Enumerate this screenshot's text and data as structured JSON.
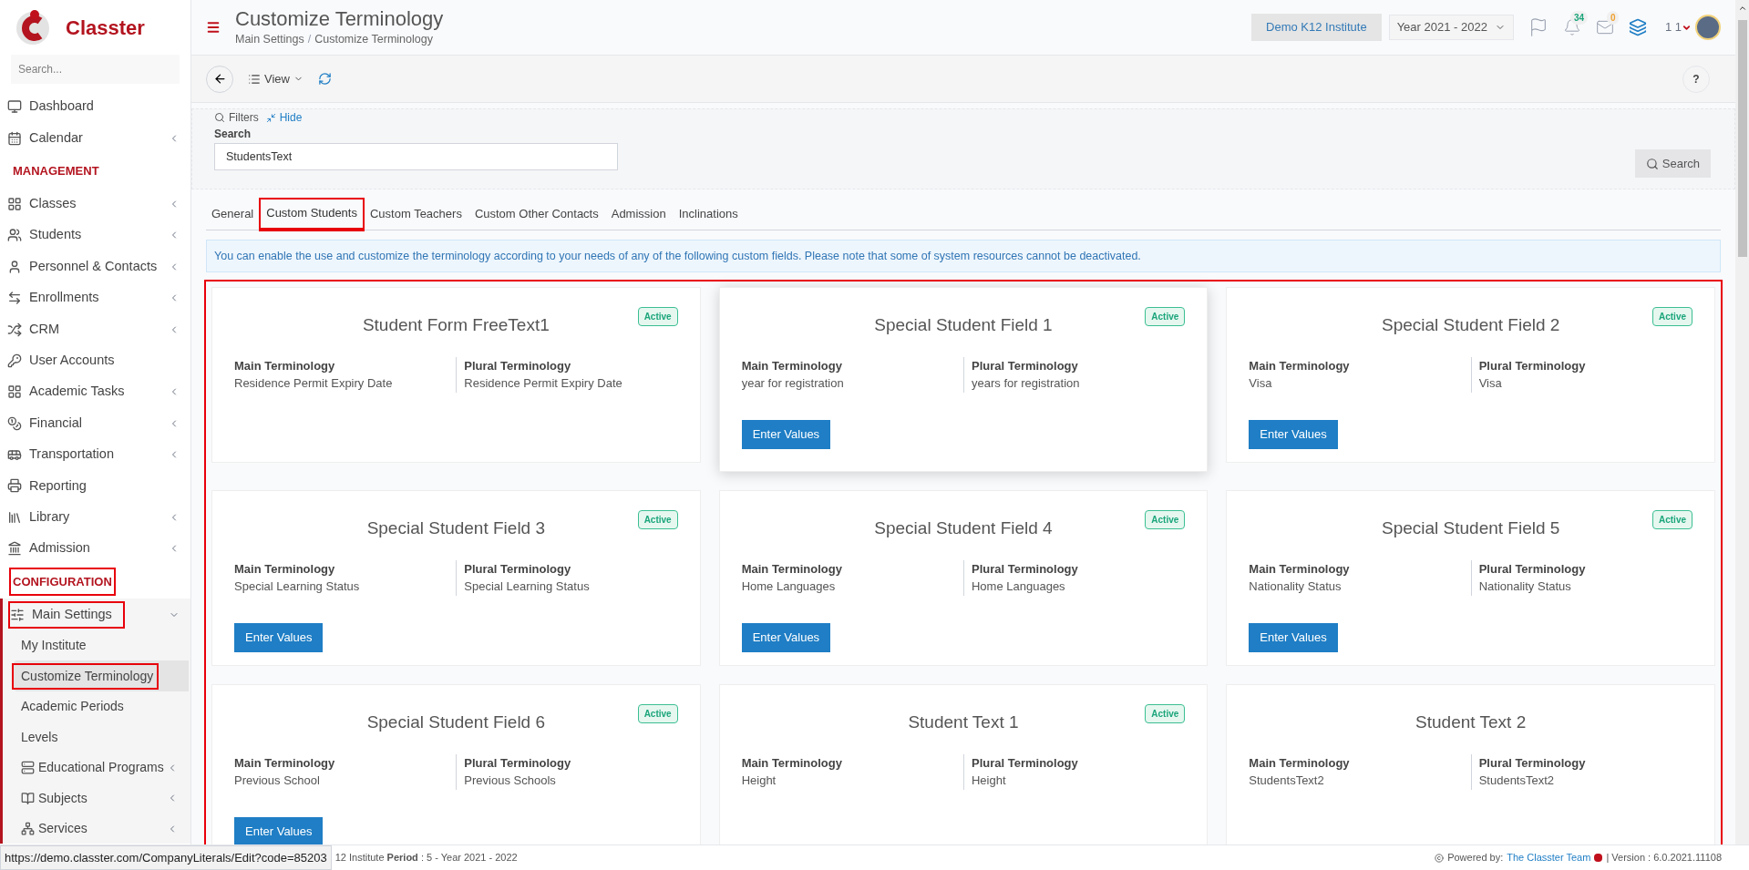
{
  "brand": {
    "name": "Classter"
  },
  "sidebar": {
    "search_placeholder": "Search...",
    "groups": [
      {
        "items": [
          {
            "label": "Dashboard",
            "has_submenu": false
          },
          {
            "label": "Calendar",
            "has_submenu": true
          }
        ]
      },
      {
        "heading": {
          "text": "MANAGEMENT",
          "annotated": false
        },
        "items": [
          {
            "label": "Classes",
            "has_submenu": true
          },
          {
            "label": "Students",
            "has_submenu": true
          },
          {
            "label": "Personnel & Contacts",
            "has_submenu": true
          },
          {
            "label": "Enrollments",
            "has_submenu": true
          },
          {
            "label": "CRM",
            "has_submenu": true
          },
          {
            "label": "User Accounts",
            "has_submenu": false
          },
          {
            "label": "Academic Tasks",
            "has_submenu": true
          },
          {
            "label": "Financial",
            "has_submenu": true
          },
          {
            "label": "Transportation",
            "has_submenu": true
          },
          {
            "label": "Reporting",
            "has_submenu": false
          },
          {
            "label": "Library",
            "has_submenu": true
          },
          {
            "label": "Admission",
            "has_submenu": true
          }
        ]
      },
      {
        "heading": {
          "text": "CONFIGURATION",
          "annotated": true
        },
        "items": [
          {
            "label": "Main Settings",
            "has_submenu": true,
            "expanded": true,
            "annotated": true,
            "children": [
              {
                "label": "My Institute",
                "selected": false,
                "annotated": false,
                "has_submenu": false
              },
              {
                "label": "Customize Terminology",
                "selected": true,
                "annotated": true,
                "has_submenu": false
              },
              {
                "label": "Academic Periods",
                "selected": false,
                "annotated": false,
                "has_submenu": false
              },
              {
                "label": "Levels",
                "selected": false,
                "annotated": false,
                "has_submenu": false
              },
              {
                "label": "Educational Programs",
                "selected": false,
                "annotated": false,
                "has_submenu": true
              },
              {
                "label": "Subjects",
                "selected": false,
                "annotated": false,
                "has_submenu": true
              },
              {
                "label": "Services",
                "selected": false,
                "annotated": false,
                "has_submenu": true
              }
            ]
          }
        ]
      }
    ]
  },
  "header": {
    "title": "Customize Terminology",
    "breadcrumbs": [
      "Main Settings",
      "Customize Terminology"
    ],
    "breadcrumb_separator": "/",
    "institute": "Demo K12 Institute",
    "year": "Year 2021 - 2022",
    "notifications": "34",
    "messages": "0",
    "user": "1 1"
  },
  "toolbar": {
    "view": "View",
    "help": "?"
  },
  "filters": {
    "label": "Filters",
    "hide": "Hide",
    "search_label": "Search",
    "search_value": "StudentsText",
    "search_button": "Search"
  },
  "tabs": [
    {
      "label": "General",
      "selected": false,
      "annotated": false
    },
    {
      "label": "Custom Students",
      "selected": true,
      "annotated": true
    },
    {
      "label": "Custom Teachers",
      "selected": false,
      "annotated": false
    },
    {
      "label": "Custom Other Contacts",
      "selected": false,
      "annotated": false
    },
    {
      "label": "Admission",
      "selected": false,
      "annotated": false
    },
    {
      "label": "Inclinations",
      "selected": false,
      "annotated": false
    }
  ],
  "info": "You can enable the use and customize the terminology according to your needs of any of the following custom fields. Please note that some of system resources cannot be deactivated.",
  "cards_annotated": true,
  "cards": [
    {
      "title": "Student Form FreeText1",
      "active": true,
      "badge": "Active",
      "raised": false,
      "main_label": "Main Terminology",
      "main_value": "Residence Permit Expiry Date",
      "plural_label": "Plural Terminology",
      "plural_value": "Residence Permit Expiry Date"
    },
    {
      "title": "Special Student Field 1",
      "active": true,
      "badge": "Active",
      "raised": true,
      "main_label": "Main Terminology",
      "main_value": "year for registration",
      "plural_label": "Plural Terminology",
      "plural_value": "years for registration",
      "button": "Enter Values"
    },
    {
      "title": "Special Student Field 2",
      "active": true,
      "badge": "Active",
      "raised": false,
      "main_label": "Main Terminology",
      "main_value": "Visa",
      "plural_label": "Plural Terminology",
      "plural_value": "Visa",
      "button": "Enter Values"
    },
    {
      "title": "Special Student Field 3",
      "active": true,
      "badge": "Active",
      "raised": false,
      "main_label": "Main Terminology",
      "main_value": "Special Learning Status",
      "plural_label": "Plural Terminology",
      "plural_value": "Special Learning Status",
      "button": "Enter Values"
    },
    {
      "title": "Special Student Field 4",
      "active": true,
      "badge": "Active",
      "raised": false,
      "main_label": "Main Terminology",
      "main_value": "Home Languages",
      "plural_label": "Plural Terminology",
      "plural_value": "Home Languages",
      "button": "Enter Values"
    },
    {
      "title": "Special Student Field 5",
      "active": true,
      "badge": "Active",
      "raised": false,
      "main_label": "Main Terminology",
      "main_value": "Nationality Status",
      "plural_label": "Plural Terminology",
      "plural_value": "Nationality Status",
      "button": "Enter Values"
    },
    {
      "title": "Special Student Field 6",
      "active": true,
      "badge": "Active",
      "raised": false,
      "main_label": "Main Terminology",
      "main_value": "Previous School",
      "plural_label": "Plural Terminology",
      "plural_value": "Previous Schools",
      "button": "Enter Values"
    },
    {
      "title": "Student Text 1",
      "active": true,
      "badge": "Active",
      "raised": false,
      "main_label": "Main Terminology",
      "main_value": "Height",
      "plural_label": "Plural Terminology",
      "plural_value": "Height"
    },
    {
      "title": "Student Text 2",
      "active": false,
      "raised": false,
      "main_label": "Main Terminology",
      "main_value": "StudentsText2",
      "plural_label": "Plural Terminology",
      "plural_value": "StudentsText2"
    }
  ],
  "footer": {
    "status": "12 Institute **Period** : 5 - Year 2021 - 2022",
    "powered": "Powered by:",
    "team": "The Classter Team",
    "version": "| Version : 6.0.2021.11108"
  },
  "link_preview": "https://demo.classter.com/CompanyLiterals/Edit?code=85203"
}
